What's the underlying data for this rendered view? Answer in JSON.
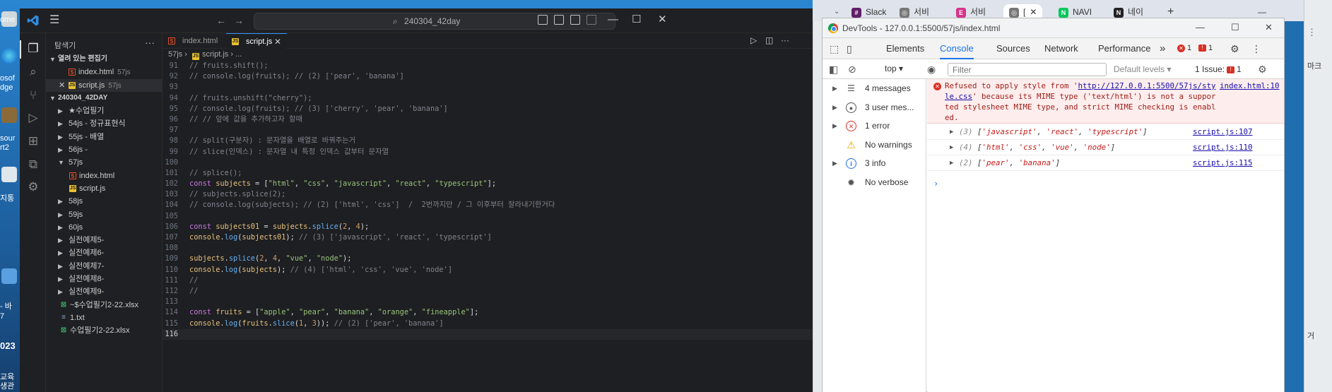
{
  "desktop": {
    "left_labels": [
      "ome",
      "osof",
      "dge",
      "sour",
      "rt2",
      "지통",
      "- 바",
      "7",
      "023",
      "교육",
      "생관"
    ],
    "right_labels": [
      "마크",
      "거"
    ]
  },
  "vscode": {
    "search_text": "240304_42day",
    "explorer": {
      "title": "탐색기",
      "open_editors_label": "열려 있는 편집기",
      "open_editors": [
        {
          "name": "index.html",
          "meta": "57js"
        },
        {
          "name": "script.js",
          "meta": "57js"
        }
      ],
      "workspace_label": "240304_42DAY",
      "folders": [
        "★수업필기",
        "54js - 정규표현식",
        "55js - 배열",
        "56js -",
        "57js"
      ],
      "folder_57_children": [
        "index.html",
        "script.js"
      ],
      "folders_after": [
        "58js",
        "59js",
        "60js",
        "실전예제5-",
        "실전예제6-",
        "실전예제7-",
        "실전예제8-",
        "실전예제9-"
      ],
      "files": [
        "~$수업필기2-22.xlsx",
        "1.txt",
        "수업필기2-22.xlsx"
      ]
    },
    "tabs": [
      {
        "label": "index.html"
      },
      {
        "label": "script.js"
      }
    ],
    "breadcrumb": {
      "folder": "57js",
      "file": "script.js",
      "rest": "..."
    },
    "code_lines": [
      {
        "n": "91",
        "t": "// fruits.shift();"
      },
      {
        "n": "92",
        "t": "// console.log(fruits); // (2) ['pear', 'banana']"
      },
      {
        "n": "93",
        "t": ""
      },
      {
        "n": "94",
        "t": "// fruits.unshift(\"cherry\");"
      },
      {
        "n": "95",
        "t": "// console.log(fruits); // (3) ['cherry', 'pear', 'banana']"
      },
      {
        "n": "96",
        "t": "// // 앞에 값을 추가하고자 할때"
      },
      {
        "n": "97",
        "t": ""
      },
      {
        "n": "98",
        "t": "// split(구분자) : 문자열을 배열로 바꿔주는거"
      },
      {
        "n": "99",
        "t": "// slice(인덱스) : 문자열 내 특정 인덱스 값부터 문자열"
      },
      {
        "n": "100",
        "t": ""
      },
      {
        "n": "101",
        "t": "// splice();"
      },
      {
        "n": "102",
        "t": "const subjects = [\"html\", \"css\", \"javascript\", \"react\", \"typescript\"];"
      },
      {
        "n": "103",
        "t": "// subjects.splice(2);"
      },
      {
        "n": "104",
        "t": "// console.log(subjects); // (2) ['html', 'css']  /  2번까지만 / 그 이후부터 잘라내기한거다"
      },
      {
        "n": "105",
        "t": ""
      },
      {
        "n": "106",
        "t": "const subjects01 = subjects.splice(2, 4);"
      },
      {
        "n": "107",
        "t": "console.log(subjects01); // (3) ['javascript', 'react', 'typescript']"
      },
      {
        "n": "108",
        "t": ""
      },
      {
        "n": "109",
        "t": "subjects.splice(2, 4, \"vue\", \"node\");"
      },
      {
        "n": "110",
        "t": "console.log(subjects); // (4) ['html', 'css', 'vue', 'node']"
      },
      {
        "n": "111",
        "t": "//"
      },
      {
        "n": "112",
        "t": "//"
      },
      {
        "n": "113",
        "t": ""
      },
      {
        "n": "114",
        "t": "const fruits = [\"apple\", \"pear\", \"banana\", \"orange\", \"fineapple\"];"
      },
      {
        "n": "115",
        "t": "console.log(fruits.slice(1, 3)); // (2) ['pear', 'banana']"
      },
      {
        "n": "116",
        "t": ""
      }
    ]
  },
  "chrome": {
    "tabs": [
      "Slack",
      "서비",
      "서비",
      "[",
      "NAVI",
      "네이"
    ],
    "new_tab": "+"
  },
  "devtools": {
    "title": "DevTools - 127.0.0.1:5500/57js/index.html",
    "panels": [
      "Elements",
      "Console",
      "Sources",
      "Network",
      "Performance"
    ],
    "more": "»",
    "error_count": "1",
    "issue_count": "1",
    "context": "top",
    "filter_placeholder": "Filter",
    "levels": "Default levels",
    "issues_label": "1 Issue:",
    "sidebar": [
      {
        "label": "4 messages",
        "icon": "list-icon"
      },
      {
        "label": "3 user mes...",
        "icon": "user-icon"
      },
      {
        "label": "1 error",
        "icon": "error-icon"
      },
      {
        "label": "No warnings",
        "icon": "warning-icon"
      },
      {
        "label": "3 info",
        "icon": "info-icon"
      },
      {
        "label": "No verbose",
        "icon": "bug-icon"
      }
    ],
    "error_message": {
      "prefix": "Refused to apply style from '",
      "url": "http://127.0.0.1:5500/57js/style.css",
      "suffix": "' because its MIME type ('text/html') is not a supported stylesheet MIME type, and strict MIME checking is enabled.",
      "source": "index.html:10"
    },
    "logs": [
      {
        "count": "(3)",
        "items": [
          "'javascript'",
          "'react'",
          "'typescript'"
        ],
        "source": "script.js:107"
      },
      {
        "count": "(4)",
        "items": [
          "'html'",
          "'css'",
          "'vue'",
          "'node'"
        ],
        "source": "script.js:110"
      },
      {
        "count": "(2)",
        "items": [
          "'pear'",
          "'banana'"
        ],
        "source": "script.js:115"
      }
    ],
    "prompt": "›"
  }
}
